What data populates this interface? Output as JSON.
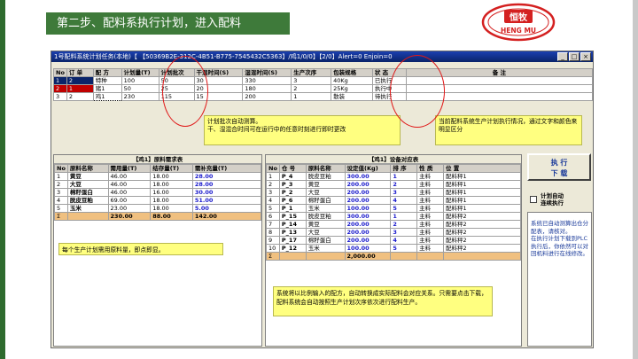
{
  "banner": "第二步、配料系执行计划，进入配料",
  "logo": {
    "text_top": "恒牧",
    "text_bottom": "HENG MU"
  },
  "window": {
    "title": "1号配料系统计划任务(本地)【 【50369B2E-312C-4B51-B775-7545432C5363】/鸡1/0/0】【2/0】Alert=0 Enjoin=0",
    "buttons": [
      "_",
      "□",
      "×"
    ]
  },
  "task_table": {
    "headers": [
      "No",
      "订 单",
      "配 方",
      "计划量(T)",
      "计划批次",
      "干混时间(S)",
      "湿混时间(S)",
      "生产次序",
      "包装规格",
      "状 态",
      "备 注"
    ],
    "rows": [
      [
        "1",
        "2",
        "特种",
        "100",
        "50",
        "30",
        "330",
        "3",
        "40Kg",
        "已执行",
        ""
      ],
      [
        "2",
        "1",
        "猪1",
        "50",
        "25",
        "20",
        "180",
        "2",
        "25Kg",
        "执行中",
        ""
      ],
      [
        "3",
        "2",
        "鸡1",
        "230",
        "115",
        "15",
        "200",
        "1",
        "散装",
        "待执行",
        ""
      ]
    ]
  },
  "notes": {
    "batch": "计划批次自动测算。\n干、湿混合时间可在运行中的任意时刻进行即时更改",
    "status": "当前配料系统生产计划执行情况，通过文字和颜色来明显区分",
    "materials": "每个生产计划需用原料量，即点即显。",
    "bins": "系统将以比例输入的配方，自动转换成实际配料会对应关系。只需要点击下载，配料系统会自动按照生产计划次序依次进行配料生产。",
    "side": "系统已自动测算出仓分配表，请核对。\n在执行计划下载到PLC执行后，你依然可以对回机料进行在线修改。"
  },
  "materials_table": {
    "title": "【鸡1】原料需求表",
    "headers": [
      "No",
      "原料名称",
      "需用量(T)",
      "结存量(T)",
      "需补充量(T)"
    ],
    "rows": [
      [
        "1",
        "黄豆",
        "46.00",
        "18.00",
        "28.00"
      ],
      [
        "2",
        "大豆",
        "46.00",
        "18.00",
        "28.00"
      ],
      [
        "3",
        "棉籽蛋白",
        "46.00",
        "16.00",
        "30.00"
      ],
      [
        "4",
        "脱皮豆粕",
        "69.00",
        "18.00",
        "51.00"
      ],
      [
        "5",
        "玉米",
        "23.00",
        "18.00",
        "5.00"
      ]
    ],
    "sum": [
      "Σ",
      "",
      "230.00",
      "88.00",
      "142.00"
    ]
  },
  "bins_table": {
    "title": "【鸡1】设备对应表",
    "headers": [
      "No",
      "仓 号",
      "原料名称",
      "设定值(Kg)",
      "排 序",
      "性 质",
      "位 置"
    ],
    "rows": [
      [
        "1",
        "P_4",
        "脱皮豆粕",
        "300.00",
        "1",
        "主料",
        "配料秤1"
      ],
      [
        "2",
        "P_3",
        "黄豆",
        "200.00",
        "2",
        "主料",
        "配料秤1"
      ],
      [
        "3",
        "P_2",
        "大豆",
        "200.00",
        "3",
        "主料",
        "配料秤1"
      ],
      [
        "4",
        "P_6",
        "棉籽蛋白",
        "200.00",
        "4",
        "主料",
        "配料秤1"
      ],
      [
        "5",
        "P_1",
        "玉米",
        "100.00",
        "5",
        "主料",
        "配料秤1"
      ],
      [
        "6",
        "P_15",
        "脱皮豆粕",
        "300.00",
        "1",
        "主料",
        "配料秤2"
      ],
      [
        "7",
        "P_14",
        "黄豆",
        "200.00",
        "2",
        "主料",
        "配料秤2"
      ],
      [
        "8",
        "P_13",
        "大豆",
        "200.00",
        "3",
        "主料",
        "配料秤2"
      ],
      [
        "9",
        "P_17",
        "棉籽蛋白",
        "200.00",
        "4",
        "主料",
        "配料秤2"
      ],
      [
        "10",
        "P_12",
        "玉米",
        "100.00",
        "5",
        "主料",
        "配料秤2"
      ]
    ],
    "sum": [
      "Σ",
      "",
      "",
      "2,000.00",
      "",
      "",
      ""
    ]
  },
  "exec_button": {
    "line1": "执 行",
    "line2": "下 载"
  },
  "auto_check": {
    "label": "计划自动\n连续执行"
  },
  "colors": {
    "banner_bg": "#3e7a3a",
    "highlight_circle": "#e01818",
    "note_bg": "#ffff80",
    "sum_bg": "#f0c080",
    "selected_row": "#0a246a",
    "running_row": "#c00000"
  }
}
